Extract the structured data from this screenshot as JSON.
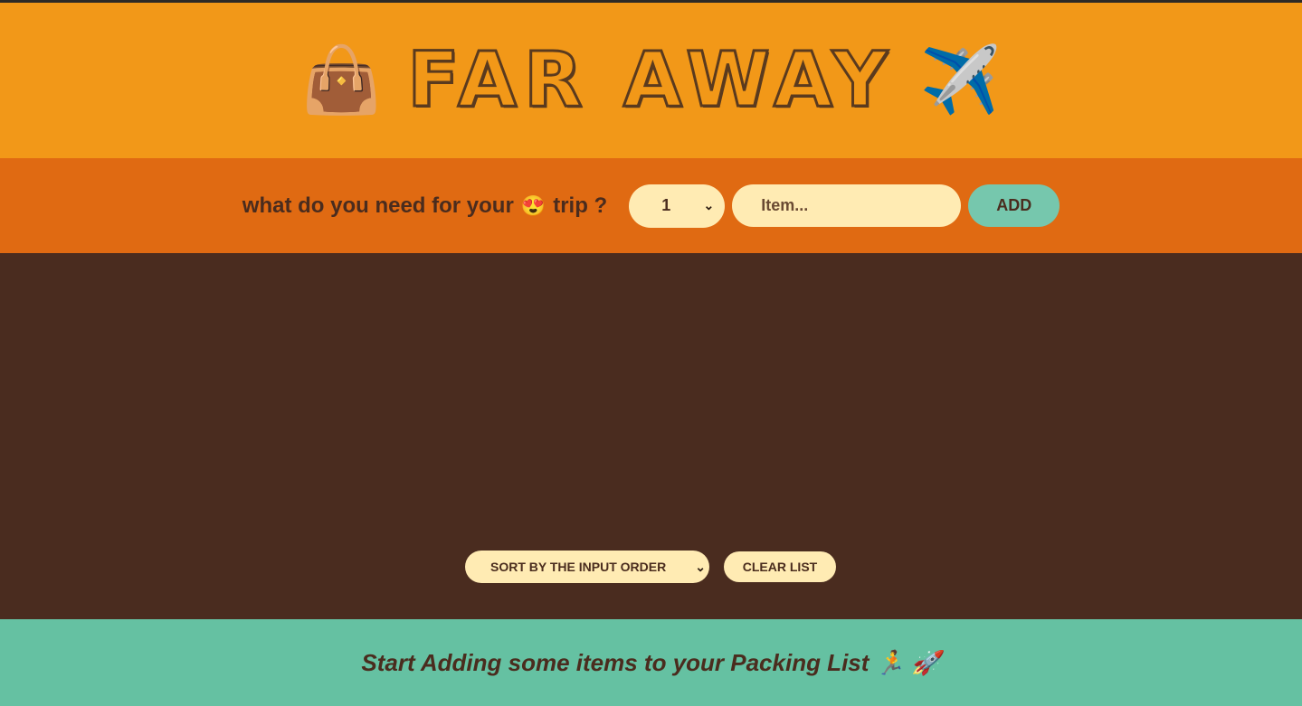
{
  "header": {
    "left_emoji": "👜",
    "title": "FAR AWAY",
    "right_emoji": "✈️"
  },
  "form": {
    "prompt_before": "what do you need for your",
    "prompt_emoji": "😍",
    "prompt_after": "trip ?",
    "quantity_value": "1",
    "item_placeholder": "Item...",
    "add_label": "ADD"
  },
  "actions": {
    "sort_selected": "SORT BY THE INPUT ORDER",
    "clear_label": "CLEAR LIST"
  },
  "footer": {
    "text": "Start Adding some items to your Packing List 🏃 🚀"
  },
  "colors": {
    "header_bg": "#f29818",
    "form_bg": "#e06a12",
    "list_bg": "#4a2c1f",
    "footer_bg": "#65c1a2",
    "cream": "#ffebb3",
    "accent_green": "#76c7ad",
    "text_brown": "#4a2c1e"
  },
  "icons": {
    "handbag": "handbag-icon",
    "airplane": "airplane-icon",
    "heart_eyes": "heart-eyes-icon",
    "select_chevron": "chevron-down-icon"
  }
}
